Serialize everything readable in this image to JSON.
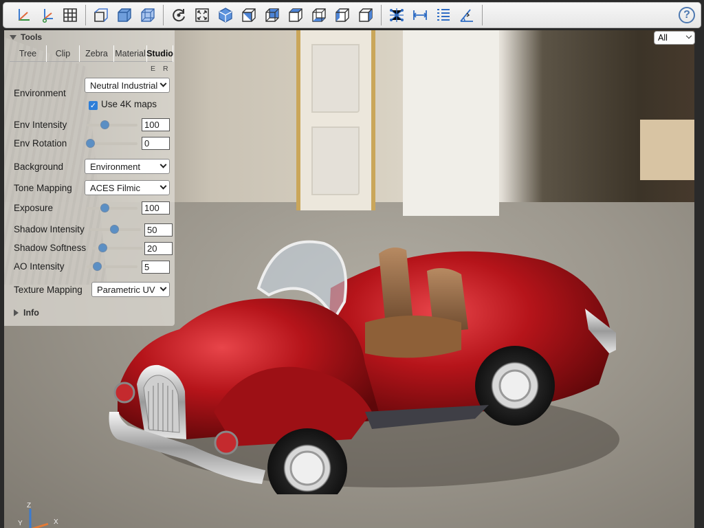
{
  "toolbar": {
    "left_buttons": [
      {
        "name": "axes-icon"
      },
      {
        "name": "axes-origin-icon"
      },
      {
        "name": "grid-icon"
      }
    ],
    "view_buttons": [
      {
        "name": "ortho-toggle-icon"
      },
      {
        "name": "cube-solid-icon"
      },
      {
        "name": "cube-wire-icon"
      }
    ],
    "camera_buttons": [
      {
        "name": "reset-view-icon"
      },
      {
        "name": "fit-view-icon"
      },
      {
        "name": "iso-view-icon"
      },
      {
        "name": "front-view-icon"
      },
      {
        "name": "rear-view-icon"
      },
      {
        "name": "top-view-icon"
      },
      {
        "name": "bottom-view-icon"
      },
      {
        "name": "left-view-icon"
      },
      {
        "name": "right-view-icon"
      }
    ],
    "tool_buttons": [
      {
        "name": "explode-icon"
      },
      {
        "name": "measure-distance-icon"
      },
      {
        "name": "properties-icon"
      },
      {
        "name": "measure-angle-icon"
      }
    ],
    "help_label": "?"
  },
  "panel": {
    "title": "Tools",
    "tabs": [
      {
        "label": "Tree",
        "active": false
      },
      {
        "label": "Clip",
        "active": false
      },
      {
        "label": "Zebra",
        "active": false
      },
      {
        "label": "Material",
        "active": false
      },
      {
        "label": "Studio",
        "active": true
      }
    ],
    "er_labels": [
      "E",
      "R"
    ],
    "environment": {
      "label": "Environment",
      "value": "Neutral Industrial"
    },
    "use_4k": {
      "label": "Use 4K maps",
      "checked": true
    },
    "env_intensity": {
      "label": "Env Intensity",
      "value": "100",
      "level": 0.35
    },
    "env_rotation": {
      "label": "Env Rotation",
      "value": "0",
      "level": 0.0
    },
    "background": {
      "label": "Background",
      "value": "Environment"
    },
    "tone_mapping": {
      "label": "Tone Mapping",
      "value": "ACES Filmic"
    },
    "exposure": {
      "label": "Exposure",
      "value": "100",
      "level": 0.35
    },
    "shadow_intensity": {
      "label": "Shadow Intensity",
      "value": "50",
      "level": 0.5
    },
    "shadow_softness": {
      "label": "Shadow Softness",
      "value": "20",
      "level": 0.2
    },
    "ao_intensity": {
      "label": "AO Intensity",
      "value": "5",
      "level": 0.2
    },
    "texture_mapping": {
      "label": "Texture Mapping",
      "value": "Parametric UV"
    },
    "info": {
      "label": "Info"
    }
  },
  "filter": {
    "value": "All"
  },
  "axes": {
    "x": "X",
    "y": "Y",
    "z": "Z"
  },
  "colors": {
    "accent": "#5b8fc4",
    "car_red": "#b5141a",
    "checkbox": "#2d7ed8"
  }
}
